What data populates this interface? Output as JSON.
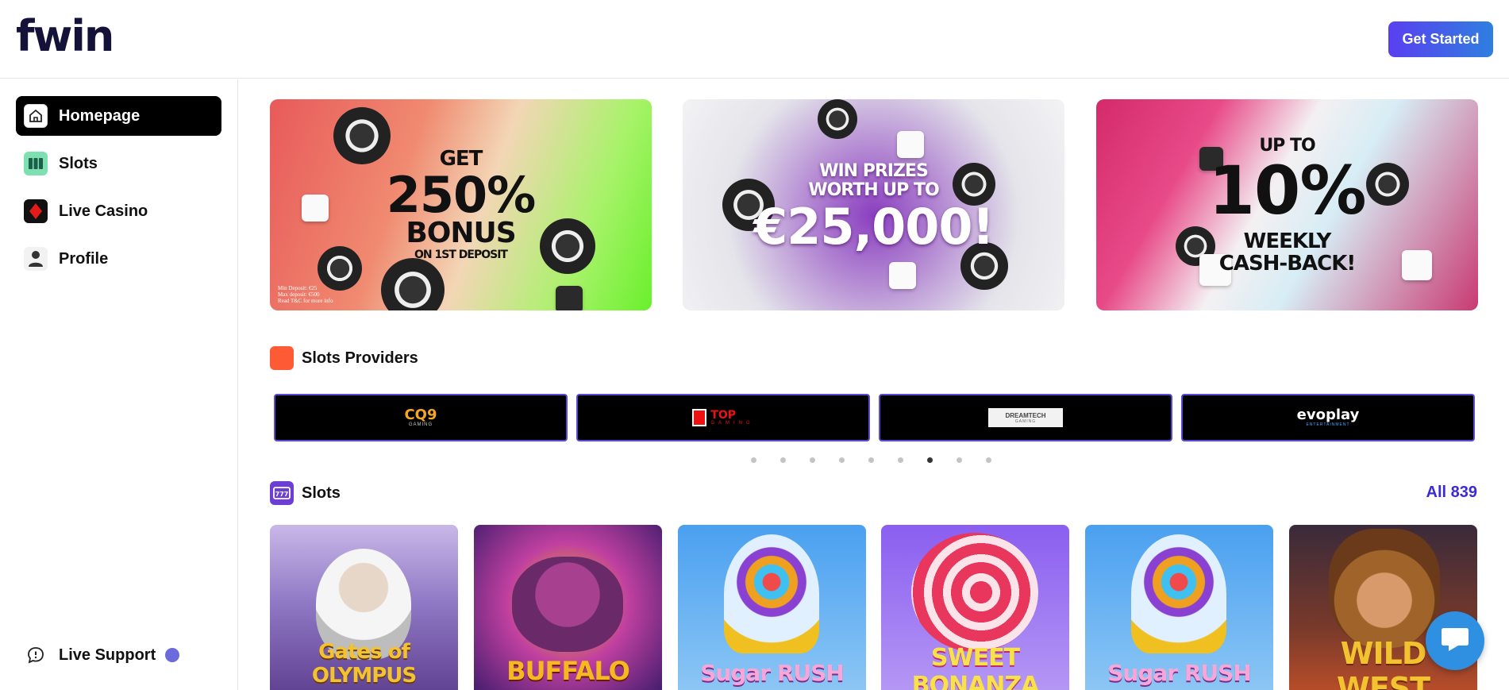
{
  "header": {
    "logo": "fwin",
    "get_started_label": "Get Started"
  },
  "sidebar": {
    "items": [
      {
        "label": "Homepage",
        "icon": "home-icon",
        "active": true
      },
      {
        "label": "Slots",
        "icon": "slots-icon",
        "active": false
      },
      {
        "label": "Live Casino",
        "icon": "diamond-icon",
        "active": false
      },
      {
        "label": "Profile",
        "icon": "user-icon",
        "active": false
      }
    ],
    "live_support_label": "Live Support"
  },
  "banners": [
    {
      "lines": [
        "GET",
        "250%",
        "BONUS",
        "ON 1ST DEPOSIT"
      ],
      "fine_print": [
        "Min Deposit: €25",
        "Max deposit: €500",
        "Read T&C for more info"
      ]
    },
    {
      "lines": [
        "WIN PRIZES",
        "WORTH UP TO",
        "€25,000!"
      ]
    },
    {
      "lines": [
        "UP TO",
        "10%",
        "WEEKLY",
        "CASH-BACK!"
      ]
    }
  ],
  "providers_section": {
    "title": "Slots Providers",
    "providers": [
      {
        "name": "CQ9",
        "sub": "GAMING"
      },
      {
        "name": "TOP",
        "sub": "GAMING"
      },
      {
        "name": "DREAMTECH",
        "sub": "GAMING"
      },
      {
        "name": "evoplay",
        "sub": "ENTERTAINMENT"
      }
    ],
    "pagination": {
      "total": 9,
      "active_index": 6
    }
  },
  "slots_section": {
    "title": "Slots",
    "all_label": "All 839",
    "games": [
      {
        "title": "Gates of OLYMPUS"
      },
      {
        "title": "BUFFALO"
      },
      {
        "title": "Sugar RUSH"
      },
      {
        "title": "SWEET BONANZA"
      },
      {
        "title": "Sugar RUSH"
      },
      {
        "title": "WILD WEST"
      }
    ]
  },
  "colors": {
    "brand": "#3b2bd6",
    "accent_gradient_start": "#5a3ff0",
    "accent_gradient_end": "#2f7fe0",
    "chat_button": "#2f8fe0"
  }
}
